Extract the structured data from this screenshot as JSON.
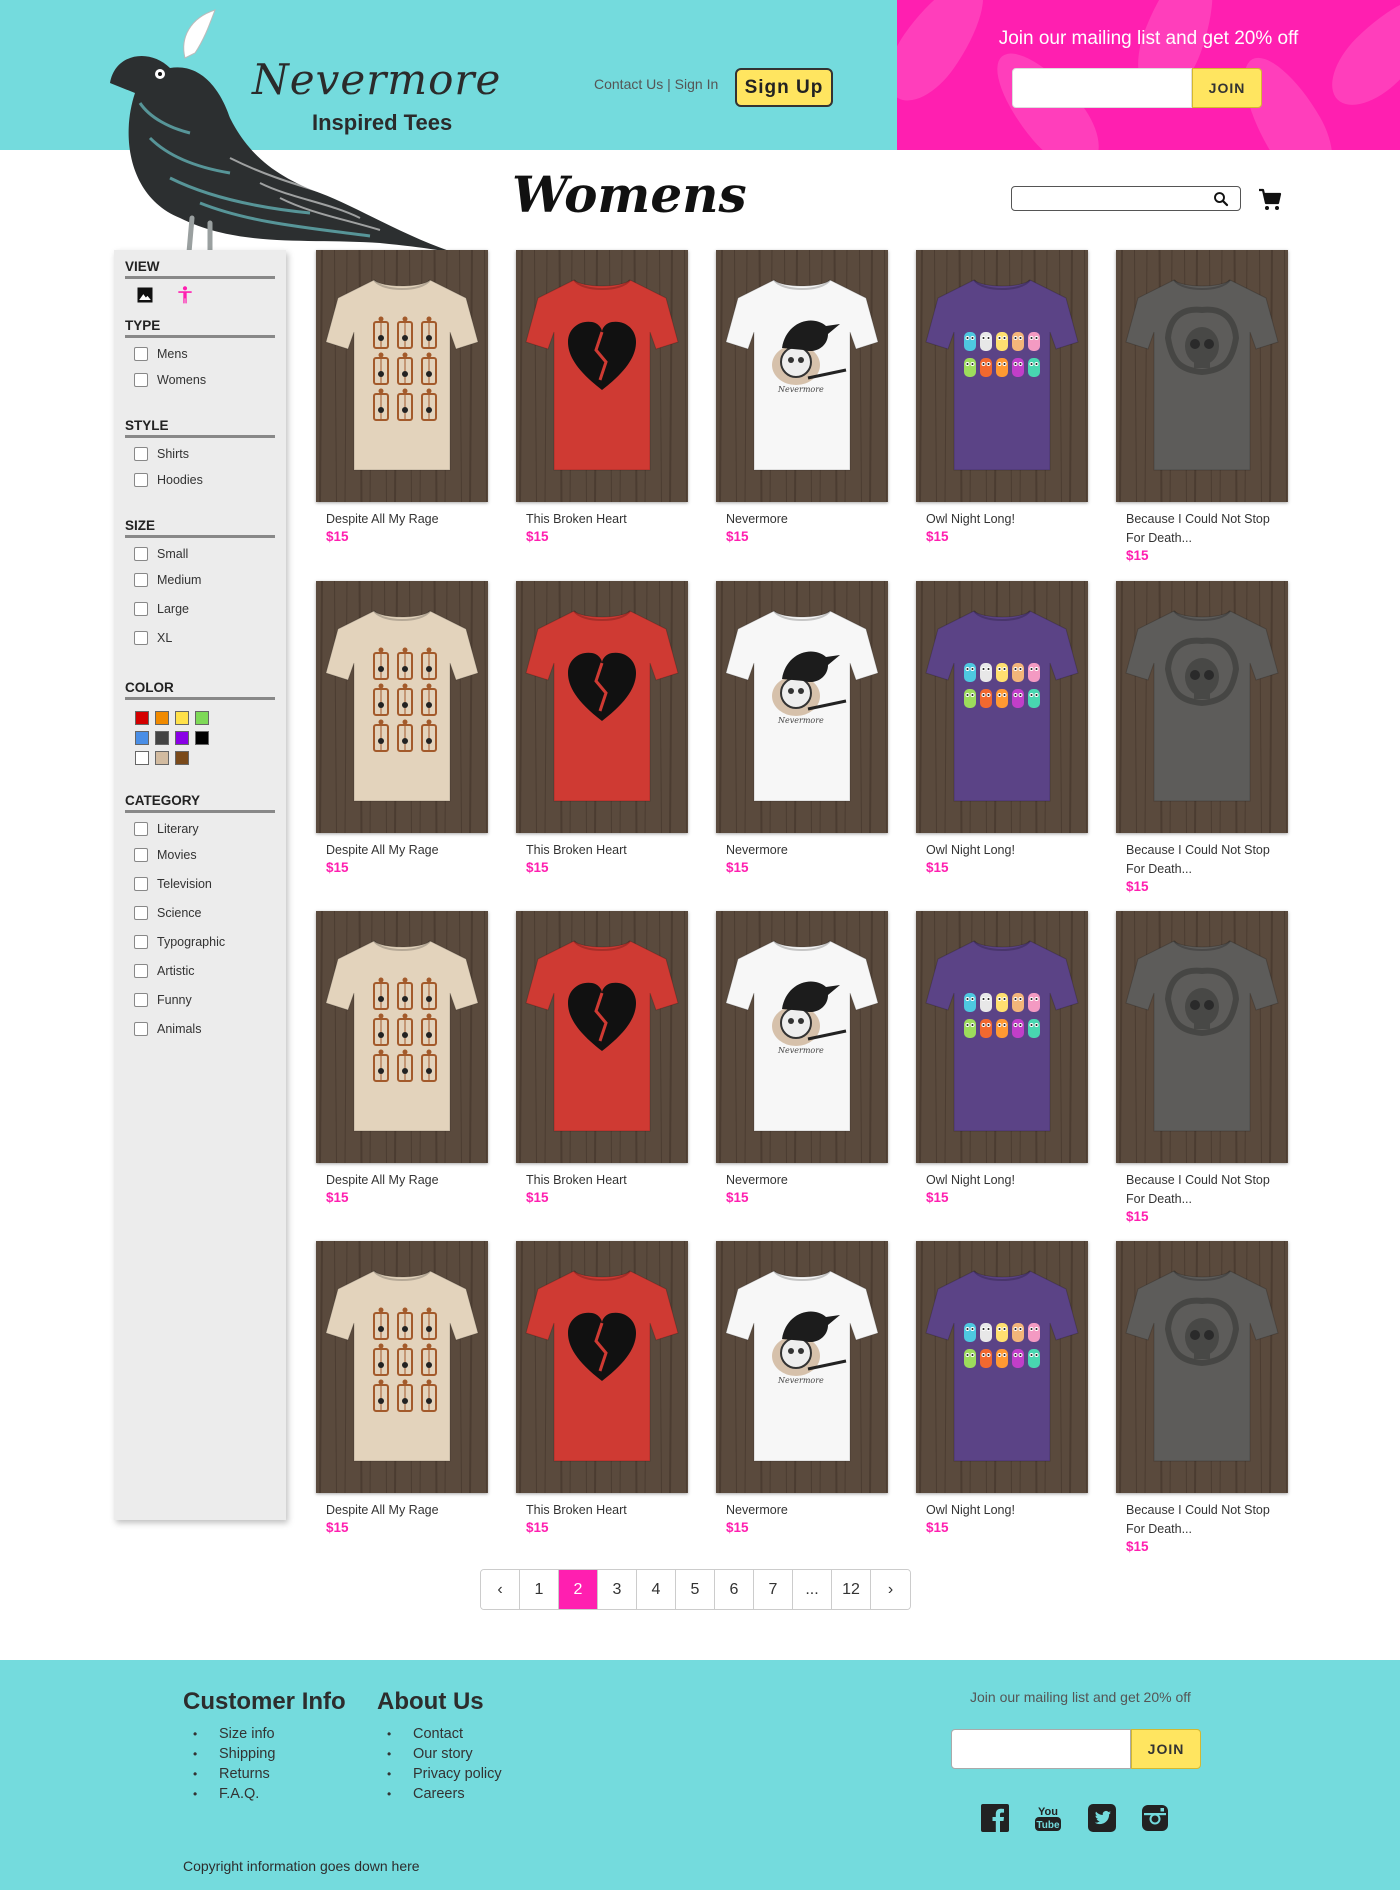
{
  "header": {
    "logo_title": "Nevermore",
    "logo_subtitle": "Inspired Tees",
    "contact_link": "Contact Us",
    "separator": " | ",
    "signin_link": "Sign In",
    "signup_label": "Sign Up",
    "promo_text": "Join our mailing list and get 20% off",
    "join_label": "JOIN"
  },
  "page": {
    "title": "Womens",
    "search_placeholder": ""
  },
  "sidebar": {
    "view_heading": "VIEW",
    "type_heading": "TYPE",
    "type_options": [
      "Mens",
      "Womens"
    ],
    "style_heading": "STYLE",
    "style_options": [
      "Shirts",
      "Hoodies"
    ],
    "size_heading": "SIZE",
    "size_options": [
      "Small",
      "Medium",
      "Large",
      "XL"
    ],
    "color_heading": "COLOR",
    "colors": [
      "#d40000",
      "#f08a00",
      "#ffe14a",
      "#7ed957",
      "#4a8ee6",
      "#444444",
      "#8a00e6",
      "#000000",
      "#ffffff",
      "#d2bba0",
      "#7a4a1a"
    ],
    "category_heading": "CATEGORY",
    "category_options": [
      "Literary",
      "Movies",
      "Television",
      "Science",
      "Typographic",
      "Artistic",
      "Funny",
      "Animals"
    ]
  },
  "products": [
    {
      "name": "Despite All My Rage",
      "price": "$15",
      "shirt_color": "#e3d3bc",
      "design": "cages"
    },
    {
      "name": "This Broken Heart",
      "price": "$15",
      "shirt_color": "#cf3a33",
      "design": "heart"
    },
    {
      "name": "Nevermore",
      "price": "$15",
      "shirt_color": "#f7f7f7",
      "design": "raven"
    },
    {
      "name": "Owl Night Long!",
      "price": "$15",
      "shirt_color": "#5b4386",
      "design": "owls"
    },
    {
      "name": "Because I Could Not Stop For Death...",
      "price": "$15",
      "shirt_color": "#5d5c5a",
      "design": "skull"
    }
  ],
  "pagination": {
    "prev": "‹",
    "pages": [
      "1",
      "2",
      "3",
      "4",
      "5",
      "6",
      "7",
      "...",
      "12"
    ],
    "current": "2",
    "next": "›"
  },
  "footer": {
    "customer_heading": "Customer Info",
    "customer_links": [
      "Size info",
      "Shipping",
      "Returns",
      "F.A.Q."
    ],
    "about_heading": "About Us",
    "about_links": [
      "Contact",
      "Our story",
      "Privacy policy",
      "Careers"
    ],
    "promo_text": "Join our mailing list and get 20% off",
    "join_label": "JOIN",
    "social": [
      "facebook-icon",
      "youtube-icon",
      "twitter-icon",
      "instagram-icon"
    ],
    "copyright": "Copyright information goes down here"
  },
  "colors": {
    "teal": "#74dbdd",
    "pink": "#ff1fb0",
    "yellow": "#ffe560",
    "wood": "#5a4a3d"
  }
}
